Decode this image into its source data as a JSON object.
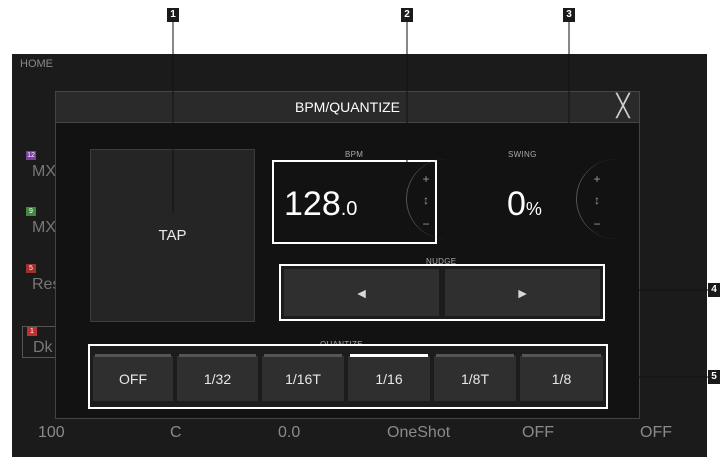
{
  "background": {
    "home_label": "HOME",
    "rows": [
      {
        "tag": "12",
        "text": "MX",
        "color": "#7a3fa0"
      },
      {
        "tag": "9",
        "text": "MX",
        "color": "#3f8a3f"
      },
      {
        "tag": "5",
        "text": "Res",
        "color": "#a03030"
      },
      {
        "tag": "1",
        "text": "Dk",
        "color": "#c03030"
      }
    ],
    "bottom_values": [
      "100",
      "C",
      "0.0",
      "OneShot",
      "OFF",
      "OFF"
    ]
  },
  "dialog": {
    "title": "BPM/QUANTIZE",
    "tap_label": "TAP",
    "bpm_label": "BPM",
    "bpm_value": "128",
    "bpm_decimal": ".0",
    "swing_label": "SWING",
    "swing_value": "0",
    "swing_unit": "%",
    "nudge_label": "NUDGE",
    "quantize_label": "QUANTIZE",
    "quantize_options": [
      "OFF",
      "1/32",
      "1/16T",
      "1/16",
      "1/8T",
      "1/8"
    ],
    "quantize_selected": "1/16",
    "plus_glyph": "+",
    "minus_glyph": "−",
    "arrow_glyph": "↕",
    "nudge_left_glyph": "◄",
    "nudge_right_glyph": "►",
    "close_glyph": "╳"
  },
  "callouts": [
    "1",
    "2",
    "3",
    "4",
    "5"
  ]
}
